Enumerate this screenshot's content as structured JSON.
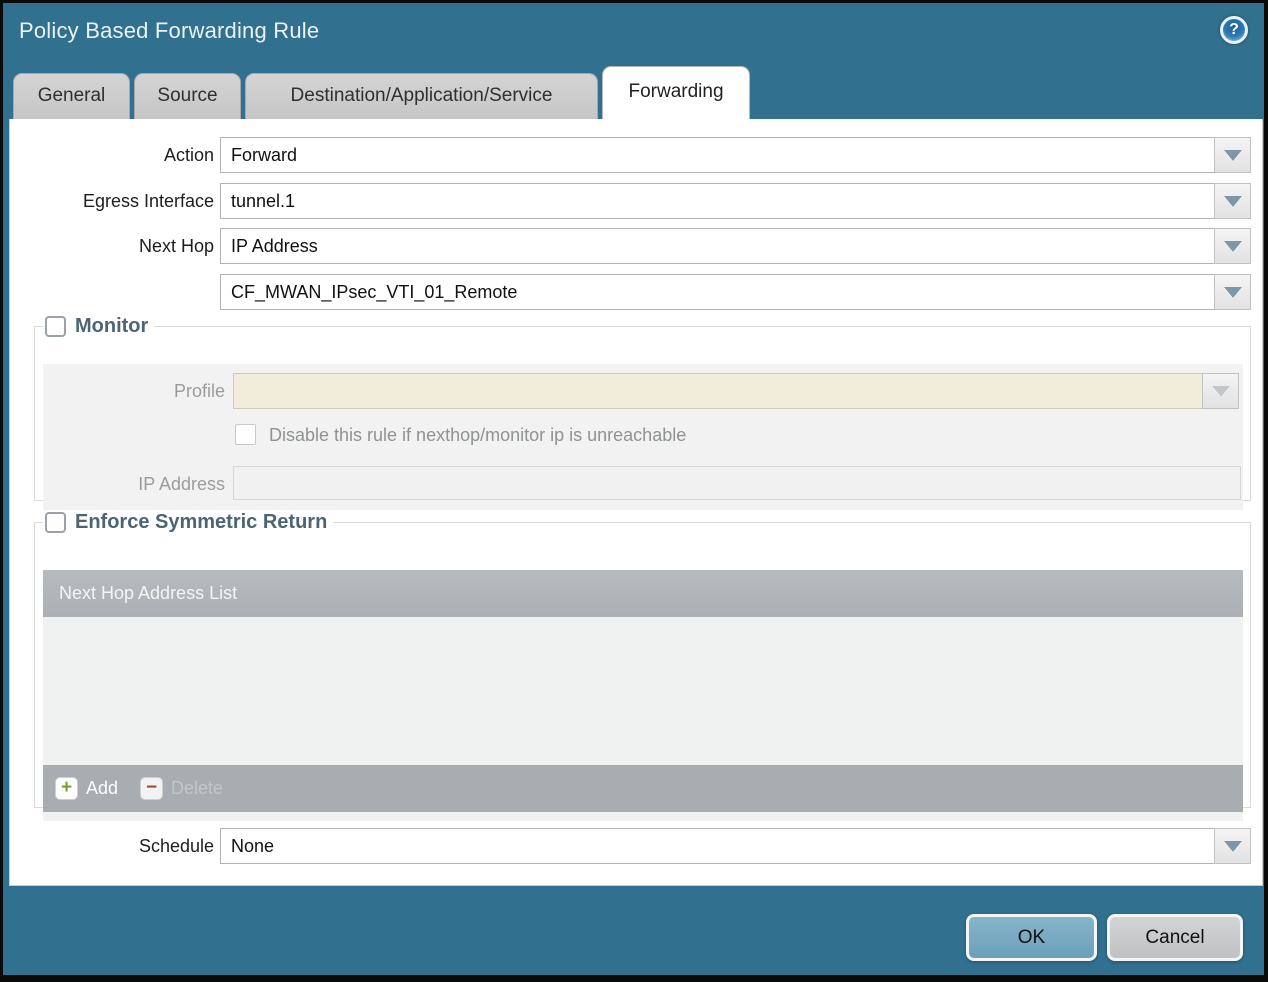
{
  "dialog": {
    "title": "Policy Based Forwarding Rule"
  },
  "icons": {
    "help": "?",
    "add_plus": "+",
    "delete_minus": "−"
  },
  "tabs": [
    {
      "label": "General",
      "active": false
    },
    {
      "label": "Source",
      "active": false
    },
    {
      "label": "Destination/Application/Service",
      "active": false
    },
    {
      "label": "Forwarding",
      "active": true
    }
  ],
  "form": {
    "action": {
      "label": "Action",
      "value": "Forward"
    },
    "egress_interface": {
      "label": "Egress Interface",
      "value": "tunnel.1"
    },
    "next_hop": {
      "label": "Next Hop",
      "value": "IP Address"
    },
    "next_hop_address": {
      "value": "CF_MWAN_IPsec_VTI_01_Remote"
    },
    "monitor": {
      "legend": "Monitor",
      "checked": false,
      "profile": {
        "label": "Profile",
        "value": "",
        "disabled": true
      },
      "disable_rule_checkbox": {
        "label": "Disable this rule if nexthop/monitor ip is unreachable",
        "checked": false
      },
      "ip_address": {
        "label": "IP Address",
        "value": ""
      }
    },
    "enforce_symmetric_return": {
      "legend": "Enforce Symmetric Return",
      "checked": false,
      "table_header": "Next Hop Address List",
      "add_label": "Add",
      "delete_label": "Delete",
      "rows": []
    },
    "schedule": {
      "label": "Schedule",
      "value": "None"
    }
  },
  "footer": {
    "ok_label": "OK",
    "cancel_label": "Cancel"
  },
  "colors": {
    "accent_teal": "#31708e",
    "tab_inactive": "#cbcbcb",
    "table_header_gray": "#b1b5b8",
    "table_footer_gray": "#a9adb1",
    "profile_disabled_bg": "#f2ecda",
    "ok_button": "#6ba0ba",
    "cancel_button": "#c6c8ca",
    "legend_text": "#4c6474"
  }
}
